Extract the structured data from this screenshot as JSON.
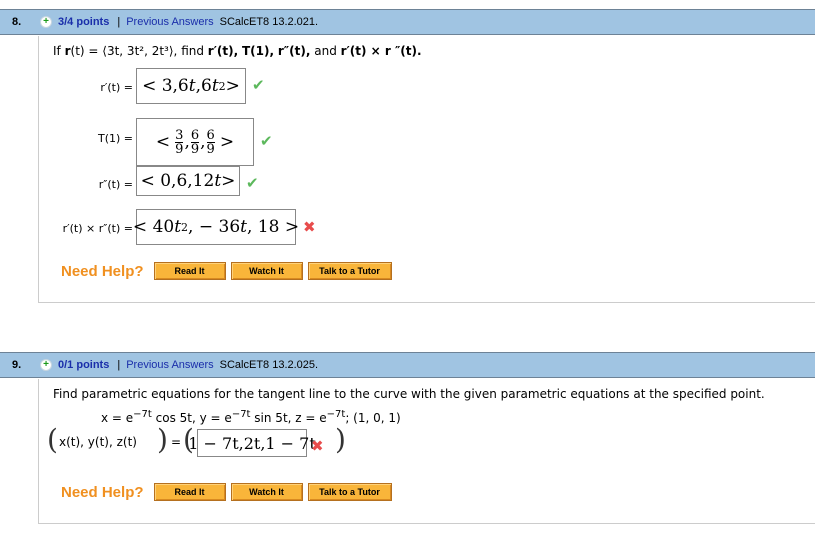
{
  "questions": [
    {
      "number": "8.",
      "points": "3/4 points",
      "separator": "|",
      "previous_answers": "Previous Answers",
      "code": "SCalcET8 13.2.021.",
      "prompt": {
        "if": "If",
        "r": "r",
        "t_arg": "(t) =",
        "vector": "⟨3t, 3t², 2t³⟩,",
        "find": "find",
        "items": [
          "r′(t),",
          "T(1),",
          "r″(t),",
          "and",
          "r′(t) × r ″(t)."
        ]
      },
      "answers": [
        {
          "label": "r′(t) =",
          "value_parts": [
            "< 3,6",
            "t",
            ",6",
            "t",
            "2",
            " >"
          ],
          "status": "correct"
        },
        {
          "label": "T(1) =",
          "value": {
            "open": "<",
            "fractions": [
              {
                "num": "3",
                "den": "9"
              },
              {
                "num": "6",
                "den": "9"
              },
              {
                "num": "6",
                "den": "9"
              }
            ],
            "close": ">"
          },
          "status": "correct"
        },
        {
          "label": "r″(t) =",
          "value_parts": [
            "< 0,6,12",
            "t",
            " >"
          ],
          "status": "correct"
        },
        {
          "label": "r′(t) × r″(t) =",
          "value_parts": [
            "< 40",
            "t",
            "2",
            ", − 36",
            "t",
            ", 18 >"
          ],
          "status": "incorrect"
        }
      ],
      "help": {
        "label": "Need Help?",
        "buttons": [
          "Read It",
          "Watch It",
          "Talk to a Tutor"
        ]
      }
    },
    {
      "number": "9.",
      "points": "0/1 points",
      "separator": "|",
      "previous_answers": "Previous Answers",
      "code": "SCalcET8 13.2.025.",
      "prompt": "Find parametric equations for the tangent line to the curve with the given parametric equations at the specified point.",
      "equation": {
        "x": "x = e",
        "x_exp": "−7t",
        "x_rest": " cos 5t, y = e",
        "y_exp": "−7t",
        "y_rest": " sin 5t, z = e",
        "z_exp": "−7t",
        "z_rest": "; (1, 0, 1)"
      },
      "answer_label": "x(t), y(t), z(t)",
      "equals": "=",
      "answer_value": "1 − 7t,2t,1 − 7t",
      "status": "incorrect",
      "help": {
        "label": "Need Help?",
        "buttons": [
          "Read It",
          "Watch It",
          "Talk to a Tutor"
        ]
      }
    }
  ],
  "icons": {
    "plus": "+",
    "check": "✔",
    "cross": "✖"
  },
  "colors": {
    "header_bg": "#a0c4e2",
    "points": "#1a2eaa",
    "correct": "#5cb85c",
    "incorrect": "#e84c4c",
    "help": "#f09020",
    "button": "#f9b53a"
  }
}
